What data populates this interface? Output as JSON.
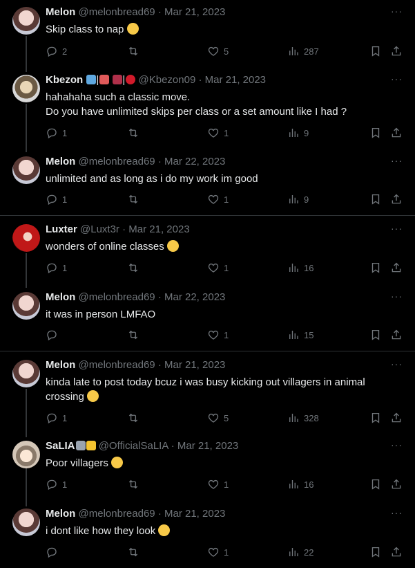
{
  "tweets": [
    {
      "name": "Melon",
      "handle": "@melonbread69",
      "date": "Mar 21, 2023",
      "line1": "Skip class to nap",
      "line2": "",
      "replies": "2",
      "retweets": "",
      "likes": "5",
      "views": "287"
    },
    {
      "name": "Kbezon",
      "handle": "@Kbezon09",
      "date": "Mar 21, 2023",
      "line1": "hahahaha such a classic move.",
      "line2": "Do you have unlimited skips per class or a set amount  like I had ?",
      "replies": "1",
      "retweets": "",
      "likes": "1",
      "views": "9"
    },
    {
      "name": "Melon",
      "handle": "@melonbread69",
      "date": "Mar 22, 2023",
      "line1": "unlimited and as long as i do my work im good",
      "line2": "",
      "replies": "1",
      "retweets": "",
      "likes": "1",
      "views": "9"
    },
    {
      "name": "Luxter",
      "handle": "@Luxt3r",
      "date": "Mar 21, 2023",
      "line1": "wonders of online classes",
      "line2": "",
      "replies": "1",
      "retweets": "",
      "likes": "1",
      "views": "16"
    },
    {
      "name": "Melon",
      "handle": "@melonbread69",
      "date": "Mar 22, 2023",
      "line1": "it was in person LMFAO",
      "line2": "",
      "replies": "",
      "retweets": "",
      "likes": "1",
      "views": "15"
    },
    {
      "name": "Melon",
      "handle": "@melonbread69",
      "date": "Mar 21, 2023",
      "line1": "kinda late to post today bcuz i was busy kicking out villagers in animal",
      "line2": "crossing",
      "replies": "1",
      "retweets": "",
      "likes": "5",
      "views": "328"
    },
    {
      "name": "SaLIA",
      "handle": "@OfficialSaLIA",
      "date": "Mar 21, 2023",
      "line1": "Poor villagers",
      "line2": "",
      "replies": "1",
      "retweets": "",
      "likes": "1",
      "views": "16"
    },
    {
      "name": "Melon",
      "handle": "@melonbread69",
      "date": "Mar 21, 2023",
      "line1": "i dont like how they look",
      "line2": "",
      "replies": "",
      "retweets": "",
      "likes": "1",
      "views": "22"
    }
  ],
  "sep": "·",
  "more": "···",
  "colors": {
    "bg": "#000000",
    "text": "#e7e9ea",
    "muted": "#71767b",
    "divider": "#2f3336"
  }
}
